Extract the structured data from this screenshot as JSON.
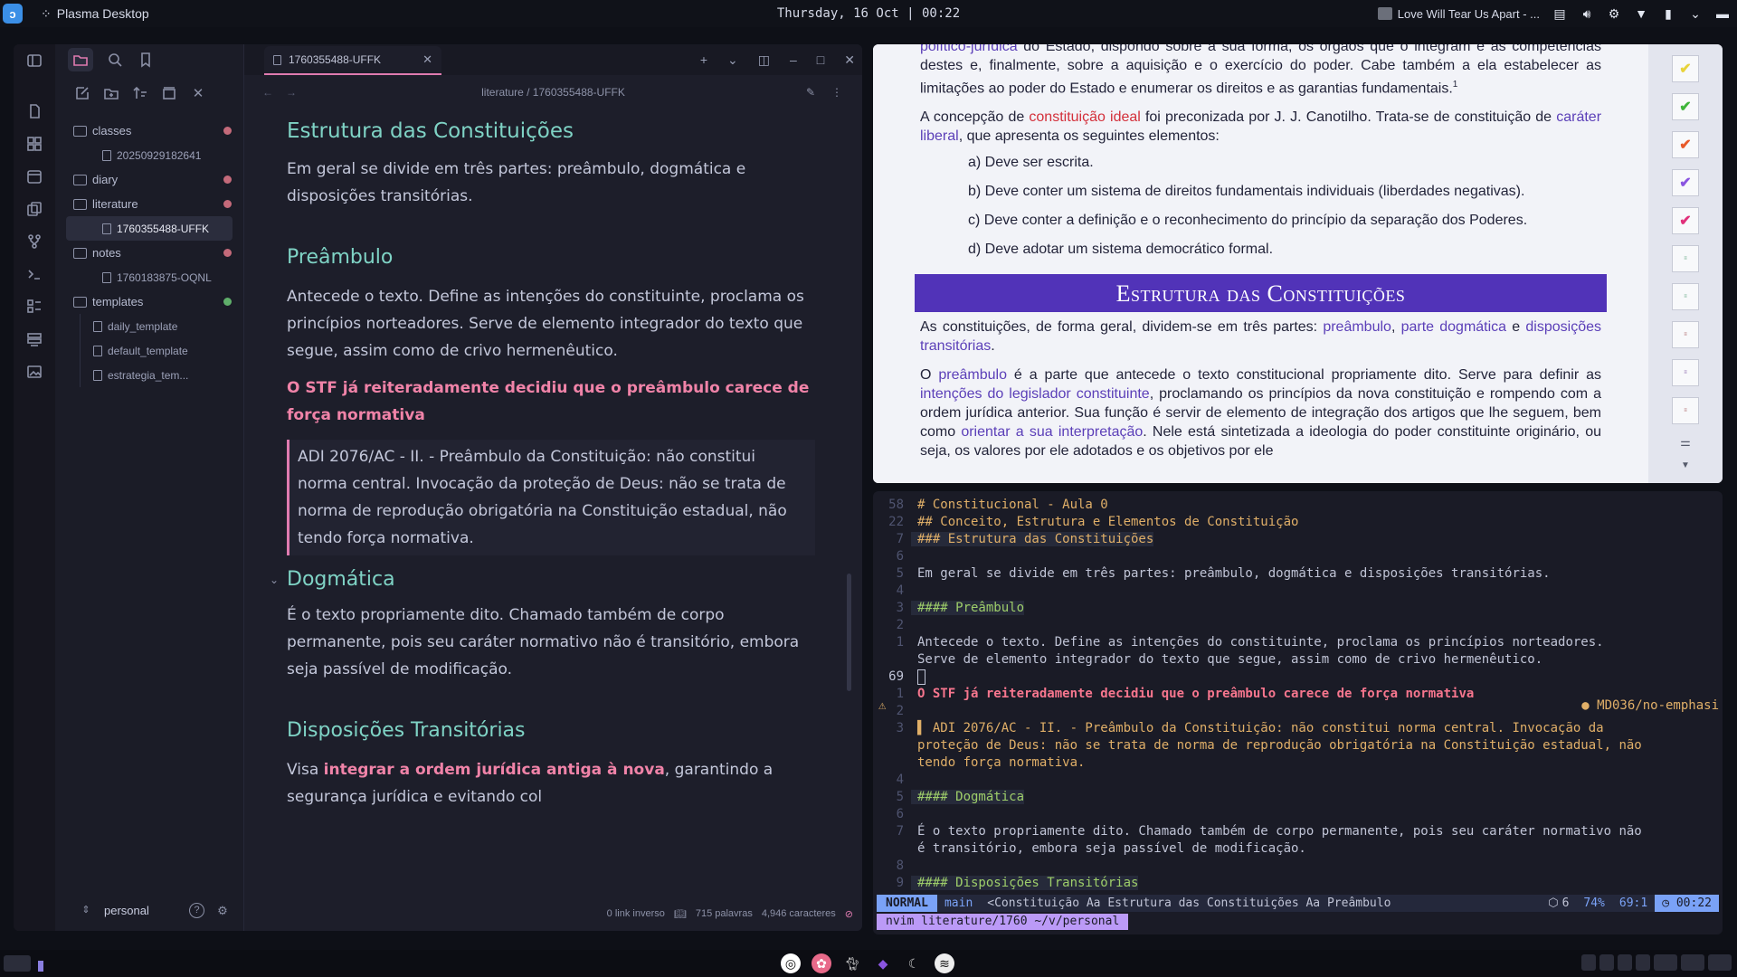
{
  "topbar": {
    "app_name": "Plasma Desktop",
    "clock": "Thursday, 16 Oct | 00:22",
    "media_title": "Love Will Tear Us Apart - ..."
  },
  "obsidian": {
    "sidebar": {
      "tree": [
        {
          "type": "folder",
          "label": "classes",
          "dot": "#c46a7a"
        },
        {
          "type": "file",
          "label": "20250929182641"
        },
        {
          "type": "folder",
          "label": "diary",
          "dot": "#c46a7a"
        },
        {
          "type": "folder",
          "label": "literature",
          "dot": "#c46a7a"
        },
        {
          "type": "file",
          "label": "1760355488-UFFK",
          "active": true
        },
        {
          "type": "folder",
          "label": "notes",
          "dot": "#c46a7a"
        },
        {
          "type": "file",
          "label": "1760183875-OQNL"
        },
        {
          "type": "folder",
          "label": "templates",
          "dot": "#5fae6a"
        }
      ],
      "templates_files": [
        "daily_template",
        "default_template",
        "estrategia_tem..."
      ],
      "vault_name": "personal"
    },
    "tab_title": "1760355488-UFFK",
    "breadcrumb": "literature / 1760355488-UFFK",
    "content": {
      "h_estrutura": "Estrutura das Constituições",
      "p_estrutura": "Em geral se divide em três partes: preâmbulo, dogmática e disposições transitórias.",
      "h_preambulo": "Preâmbulo",
      "p_preambulo": "Antecede o texto. Define as intenções do constituinte, proclama os princípios norteadores. Serve de elemento integrador do texto que segue, assim como de crivo hermenêutico.",
      "strong_stf": "O STF já reiteradamente decidiu que o preâmbulo carece de força normativa",
      "quote_adi": "ADI 2076/AC - II. - Preâmbulo da Constituição: não constitui norma central. Invocação da proteção de Deus: não se trata de norma de reprodução obrigatória na Constituição estadual, não tendo força normativa.",
      "h_dogmatica": "Dogmática",
      "p_dogmatica": "É o texto propriamente dito. Chamado também de corpo permanente, pois seu caráter normativo não é transitório, embora seja passível de modificação.",
      "h_disposicoes": "Disposições Transitórias",
      "p_disp_start": "Visa ",
      "p_disp_strong": "integrar a ordem jurídica antiga à nova",
      "p_disp_end": ", garantindo a segurança jurídica e evitando col"
    },
    "status": {
      "backlinks": "0 link inverso",
      "words": "715 palavras",
      "chars": "4,946 caracteres"
    }
  },
  "pdf": {
    "p1_link": "político-jurídica",
    "p1_text": " do Estado, dispondo sobre a sua forma, os órgãos que o integram e as competências destes e, finalmente, sobre a aquisição e o exercício do poder. Cabe também a ela estabelecer as limitações ao poder do Estado e enumerar os direitos e as garantias fundamentais.",
    "p1_sup": "1",
    "p2_a": "A concepção de ",
    "p2_red": "constituição ideal",
    "p2_b": " foi preconizada por J. J. Canotilho. Trata-se de constituição de ",
    "p2_link": "caráter liberal",
    "p2_c": ", que apresenta os seguintes elementos:",
    "items": [
      "a) Deve ser escrita.",
      "b) Deve conter um sistema de direitos fundamentais individuais (liberdades negativas).",
      "c) Deve conter a definição e o reconhecimento do princípio da separação dos Poderes.",
      "d) Deve adotar um sistema democrático formal."
    ],
    "banner": "Estrutura das Constituições",
    "p3_a": "As constituições, de forma geral, dividem-se em três partes: ",
    "p3_l1": "preâmbulo",
    "p3_b": ", ",
    "p3_l2": "parte dogmática",
    "p3_c": " e ",
    "p3_l3": "disposições transitórias",
    "p3_d": ".",
    "p4_a": "O ",
    "p4_l1": "preâmbulo",
    "p4_b": " é a parte que antecede o texto constitucional propriamente dito. Serve para definir as ",
    "p4_l2": "intenções do legislador constituinte",
    "p4_c": ", proclamando os princípios da nova constituição e rompendo com a ordem jurídica anterior. Sua função é servir de elemento de integração dos artigos que lhe seguem, bem como ",
    "p4_l3": "orientar a sua interpretação",
    "p4_d": ". Nele está sintetizada a ideologia do poder constituinte originário, ou seja, os valores por ele adotados e os objetivos por ele",
    "thumb_colors": [
      "#e8d33a",
      "#3fb53a",
      "#e85a2a",
      "#8a55e0",
      "#e0307a"
    ]
  },
  "nvim": {
    "lines": [
      {
        "n": "58",
        "t": "# Constitucional - Aula 0",
        "c": "hd"
      },
      {
        "n": "22",
        "t": "## Conceito, Estrutura e Elementos de Constituição",
        "c": "hd"
      },
      {
        "n": "7",
        "t": "### Estrutura das Constituições",
        "c": "hd hlbox"
      },
      {
        "n": "6",
        "t": "",
        "c": ""
      },
      {
        "n": "5",
        "t": "Em geral se divide em três partes: preâmbulo, dogmática e disposições transitórias.",
        "c": ""
      },
      {
        "n": "4",
        "t": "",
        "c": ""
      },
      {
        "n": "3",
        "t": "#### Preâmbulo",
        "c": "hd4 hlbox"
      },
      {
        "n": "2",
        "t": "",
        "c": ""
      },
      {
        "n": "1",
        "t": "Antecede o texto. Define as intenções do constituinte, proclama os princípios norteadores.",
        "c": ""
      },
      {
        "n": "",
        "t": "Serve de elemento integrador do texto que segue, assim como de crivo hermenêutico.",
        "c": ""
      },
      {
        "n": "69",
        "t": "",
        "c": "cur"
      },
      {
        "n": "1",
        "t": "O STF já reiteradamente decidiu que o preâmbulo carece de força normativa",
        "c": "st"
      },
      {
        "n": "2",
        "t": "",
        "c": ""
      },
      {
        "n": "3",
        "t": "▌ ADI 2076/AC - II. - Preâmbulo da Constituição: não constitui norma central. Invocação da",
        "c": "q"
      },
      {
        "n": "",
        "t": "proteção de Deus: não se trata de norma de reprodução obrigatória na Constituição estadual, não",
        "c": "q"
      },
      {
        "n": "",
        "t": "tendo força normativa.",
        "c": "q"
      },
      {
        "n": "4",
        "t": "",
        "c": ""
      },
      {
        "n": "5",
        "t": "#### Dogmática",
        "c": "hd4 hlbox"
      },
      {
        "n": "6",
        "t": "",
        "c": ""
      },
      {
        "n": "7",
        "t": "É o texto propriamente dito. Chamado também de corpo permanente, pois seu caráter normativo não",
        "c": ""
      },
      {
        "n": "",
        "t": "é transitório, embora seja passível de modificação.",
        "c": ""
      },
      {
        "n": "8",
        "t": "",
        "c": ""
      },
      {
        "n": "9",
        "t": "#### Disposições Transitórias",
        "c": "hd4 hlbox"
      }
    ],
    "diagnostic": "● MD036/no-emphasi",
    "status": {
      "mode": "NORMAL",
      "branch": " main",
      "crumbs": "<Constituição  Aa Estrutura das Constituições  Aa Preâmbulo",
      "count": "6",
      "percent": "74%",
      "pos": "69:1",
      "time": "00:22"
    },
    "cmdline": "nvim literature/1760 ~/v/personal"
  },
  "colors": {
    "accent": "#e07bb0",
    "heading": "#7fd3c5",
    "banner": "#5133b8"
  }
}
